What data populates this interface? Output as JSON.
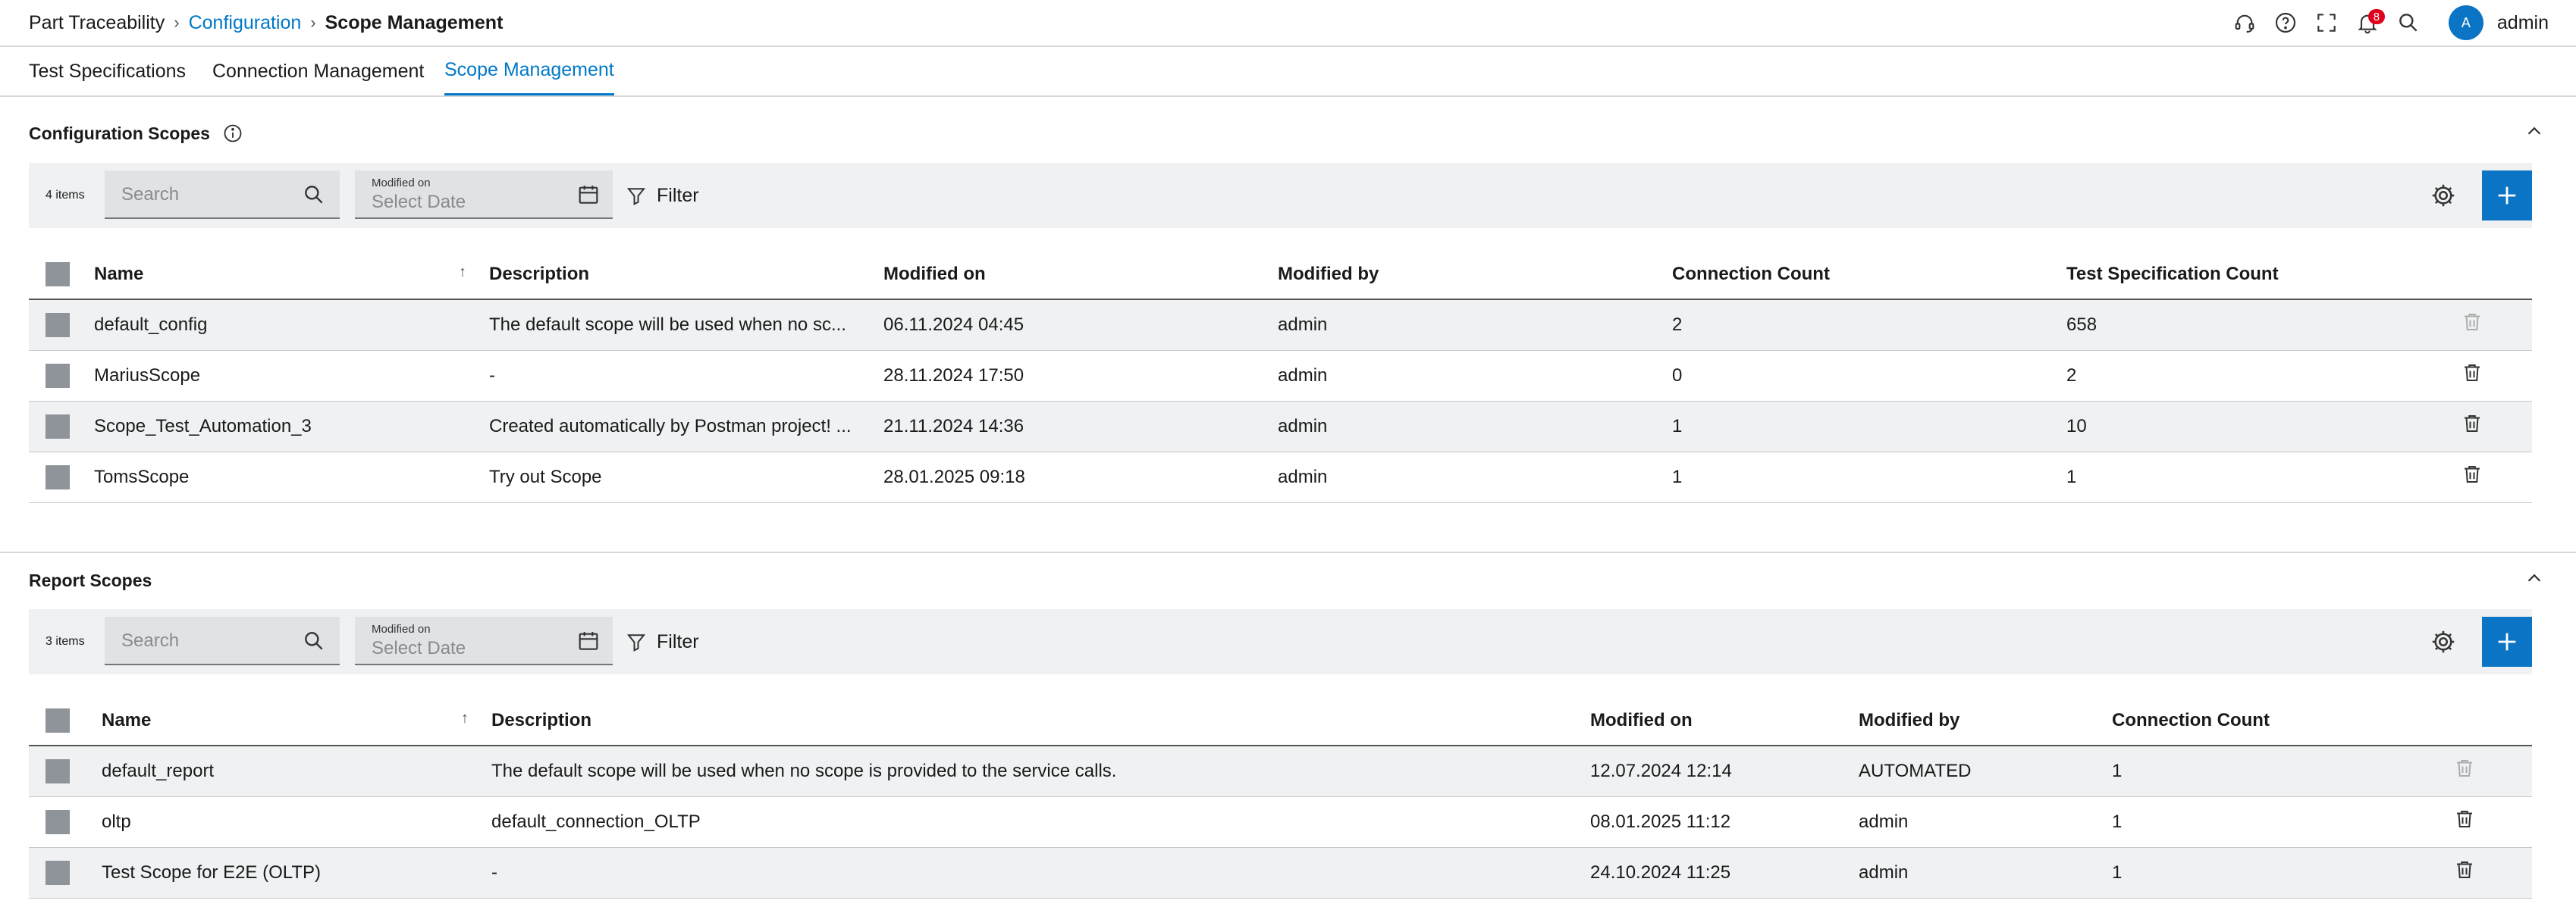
{
  "breadcrumb": {
    "items": [
      "Part Traceability",
      "Configuration",
      "Scope Management"
    ]
  },
  "header": {
    "notification_count": "8",
    "avatar_initial": "A",
    "user_name": "admin",
    "icons": [
      "headset-icon",
      "help-icon",
      "fullscreen-icon",
      "bell-icon",
      "search-icon"
    ]
  },
  "tabs": [
    {
      "label": "Test Specifications"
    },
    {
      "label": "Connection Management"
    },
    {
      "label": "Scope Management",
      "active": true
    }
  ],
  "config_scopes": {
    "title": "Configuration Scopes",
    "item_count": "4 items",
    "search_placeholder": "Search",
    "date_label": "Modified on",
    "date_placeholder": "Select Date",
    "filter_label": "Filter",
    "columns": [
      "Name",
      "Description",
      "Modified on",
      "Modified by",
      "Connection Count",
      "Test Specification Count"
    ],
    "rows": [
      {
        "name": "default_config",
        "description": "The default scope will be used when no sc...",
        "modified_on": "06.11.2024 04:45",
        "modified_by": "admin",
        "connection_count": "2",
        "test_spec_count": "658"
      },
      {
        "name": "MariusScope",
        "description": "-",
        "modified_on": "28.11.2024 17:50",
        "modified_by": "admin",
        "connection_count": "0",
        "test_spec_count": "2"
      },
      {
        "name": "Scope_Test_Automation_3",
        "description": "Created automatically by Postman project! ...",
        "modified_on": "21.11.2024 14:36",
        "modified_by": "admin",
        "connection_count": "1",
        "test_spec_count": "10"
      },
      {
        "name": "TomsScope",
        "description": "Try out Scope",
        "modified_on": "28.01.2025 09:18",
        "modified_by": "admin",
        "connection_count": "1",
        "test_spec_count": "1"
      }
    ]
  },
  "report_scopes": {
    "title": "Report Scopes",
    "item_count": "3 items",
    "search_placeholder": "Search",
    "date_label": "Modified on",
    "date_placeholder": "Select Date",
    "filter_label": "Filter",
    "columns": [
      "Name",
      "Description",
      "Modified on",
      "Modified by",
      "Connection Count"
    ],
    "rows": [
      {
        "name": "default_report",
        "description": "The default scope will be used when no scope is provided to the service calls.",
        "modified_on": "12.07.2024 12:14",
        "modified_by": "AUTOMATED",
        "connection_count": "1"
      },
      {
        "name": "oltp",
        "description": "default_connection_OLTP",
        "modified_on": "08.01.2025 11:12",
        "modified_by": "admin",
        "connection_count": "1"
      },
      {
        "name": "Test Scope for E2E (OLTP)",
        "description": "-",
        "modified_on": "24.10.2024 11:25",
        "modified_by": "admin",
        "connection_count": "1"
      }
    ]
  },
  "colors": {
    "accent": "#0078c8",
    "button": "#0b74c4",
    "badge": "#e0001e"
  }
}
